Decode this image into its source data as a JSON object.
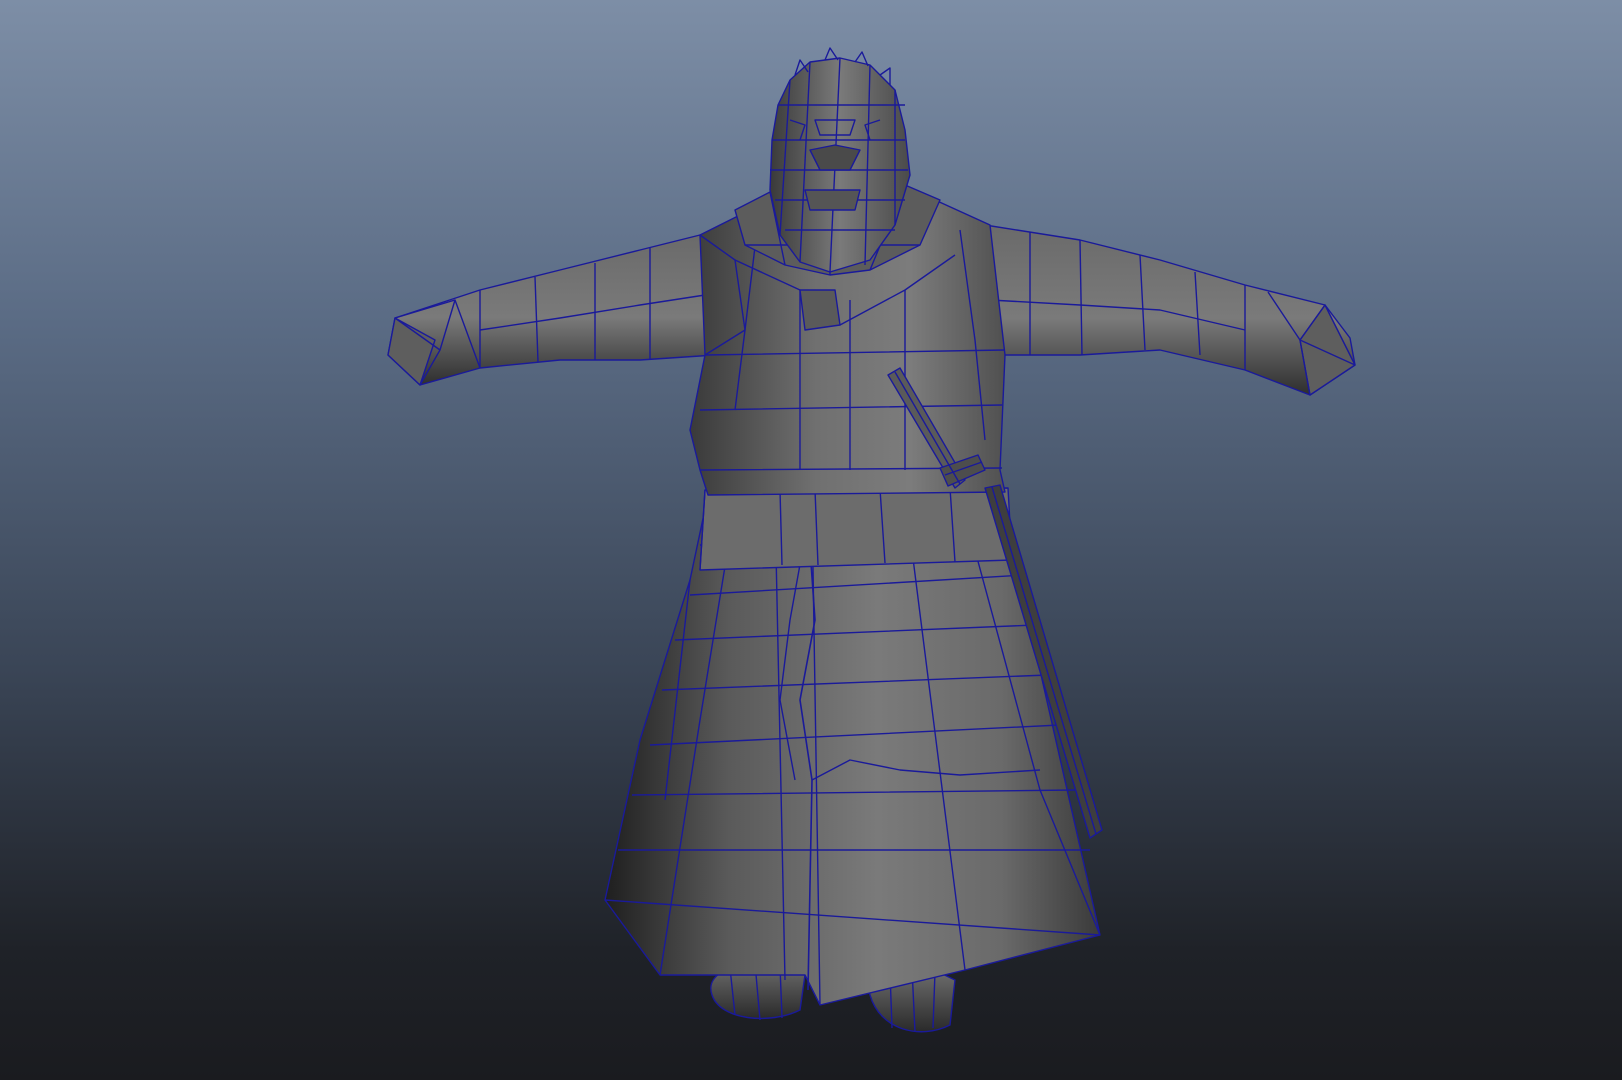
{
  "viewport": {
    "background_top": "#7d8ea6",
    "background_bottom": "#1a1b1f"
  },
  "model": {
    "display_mode": "smooth-shade-with-wireframe",
    "shade_color": "#6b6b6b",
    "wire_color": "#1a1a9a",
    "pose": "T-pose",
    "parts": [
      "head",
      "collar",
      "left-arm",
      "right-arm",
      "torso",
      "belt",
      "coat-skirt",
      "sword",
      "left-foot",
      "right-foot"
    ]
  }
}
